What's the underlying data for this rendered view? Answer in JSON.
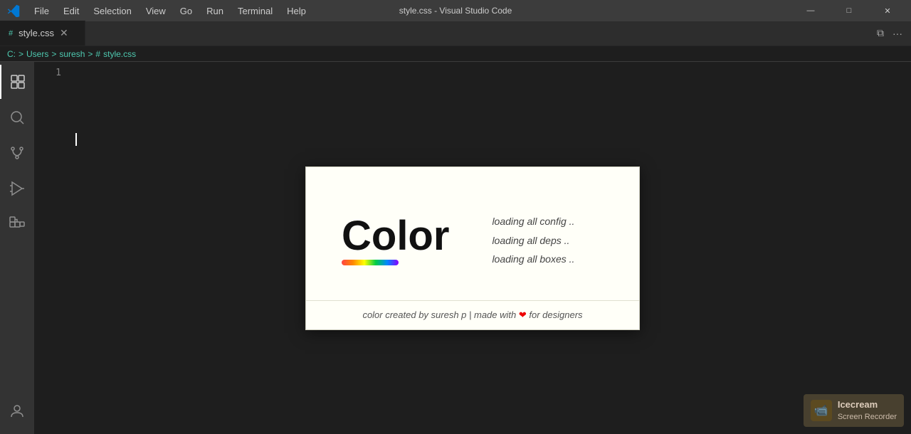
{
  "titlebar": {
    "logo": "◈",
    "menu_items": [
      "File",
      "Edit",
      "Selection",
      "View",
      "Go",
      "Run",
      "Terminal",
      "Help"
    ],
    "title": "style.css - Visual Studio Code",
    "controls": {
      "minimize": "—",
      "maximize": "□",
      "close": "✕"
    }
  },
  "tab": {
    "filename": "style.css",
    "icon": "#",
    "close_button": "✕"
  },
  "tabbar_right": {
    "split_icon": "⧉",
    "more_icon": "···"
  },
  "breadcrumb": {
    "drive": "C:",
    "sep1": ">",
    "folder1": "Users",
    "sep2": ">",
    "folder2": "suresh",
    "sep3": ">",
    "hash": "#",
    "file": "style.css"
  },
  "editor": {
    "line_number": "1"
  },
  "splash": {
    "logo_text": "Color",
    "loading_lines": [
      "loading all config ..",
      "loading all deps ..",
      "loading all boxes .."
    ],
    "footer": "color created by suresh p | made with ❤ for designers"
  },
  "watermark": {
    "brand": "Icecream",
    "sub": "Screen Recorder"
  },
  "activity_bar": {
    "items": [
      {
        "name": "explorer",
        "label": "Explorer"
      },
      {
        "name": "search",
        "label": "Search"
      },
      {
        "name": "source-control",
        "label": "Source Control"
      },
      {
        "name": "debug",
        "label": "Debug"
      },
      {
        "name": "extensions",
        "label": "Extensions"
      },
      {
        "name": "accounts",
        "label": "Accounts"
      }
    ]
  }
}
